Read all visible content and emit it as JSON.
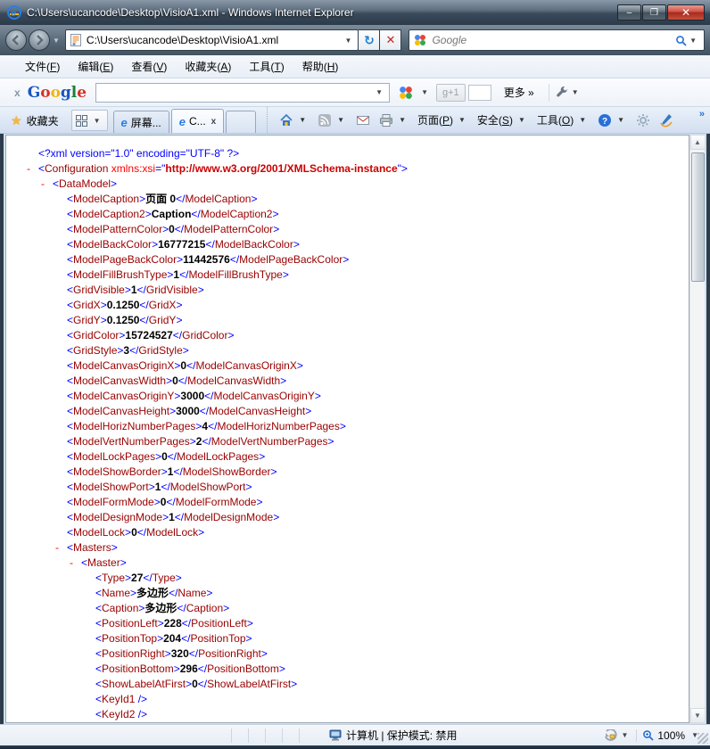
{
  "window": {
    "title": "C:\\Users\\ucancode\\Desktop\\VisioA1.xml - Windows Internet Explorer",
    "controls": {
      "minimize": "–",
      "maximize": "❐",
      "close": "✕"
    }
  },
  "nav": {
    "address": "C:\\Users\\ucancode\\Desktop\\VisioA1.xml",
    "refresh_glyph": "↻",
    "stop_glyph": "✕",
    "search_placeholder": "Google"
  },
  "menu": {
    "items": [
      "文件(F)",
      "编辑(E)",
      "查看(V)",
      "收藏夹(A)",
      "工具(T)",
      "帮助(H)"
    ]
  },
  "google_bar": {
    "close_glyph": "x",
    "logo_letters": [
      {
        "ch": "G",
        "color": "#1a56c4"
      },
      {
        "ch": "o",
        "color": "#d93025"
      },
      {
        "ch": "o",
        "color": "#f4b400"
      },
      {
        "ch": "g",
        "color": "#1a56c4"
      },
      {
        "ch": "l",
        "color": "#188038"
      },
      {
        "ch": "e",
        "color": "#d93025"
      }
    ],
    "plus_one_label": "g+1",
    "more_label": "更多 »"
  },
  "tab_bar": {
    "favorites_label": "收藏夹",
    "tabs": [
      {
        "label": "屏幕...",
        "active": false,
        "closable": false
      },
      {
        "label": "C...",
        "active": true,
        "closable": true
      }
    ],
    "text_commands": [
      {
        "label": "页面(P)"
      },
      {
        "label": "安全(S)"
      },
      {
        "label": "工具(O)"
      }
    ],
    "chevron_glyph": "»"
  },
  "content": {
    "lines": [
      {
        "type": "decl",
        "indent": 0,
        "text": "<?xml version=\"1.0\" encoding=\"UTF-8\" ?>"
      },
      {
        "type": "open",
        "indent": 0,
        "tag": "Configuration",
        "attr_name": "xmlns:xsi",
        "attr_value": "http://www.w3.org/2001/XMLSchema-instance"
      },
      {
        "type": "open",
        "indent": 1,
        "tag": "DataModel"
      },
      {
        "type": "leaf",
        "indent": 2,
        "tag": "ModelCaption",
        "value": "页面 0"
      },
      {
        "type": "leaf",
        "indent": 2,
        "tag": "ModelCaption2",
        "value": "Caption"
      },
      {
        "type": "leaf",
        "indent": 2,
        "tag": "ModelPatternColor",
        "value": "0"
      },
      {
        "type": "leaf",
        "indent": 2,
        "tag": "ModelBackColor",
        "value": "16777215"
      },
      {
        "type": "leaf",
        "indent": 2,
        "tag": "ModelPageBackColor",
        "value": "11442576"
      },
      {
        "type": "leaf",
        "indent": 2,
        "tag": "ModelFillBrushType",
        "value": "1"
      },
      {
        "type": "leaf",
        "indent": 2,
        "tag": "GridVisible",
        "value": "1"
      },
      {
        "type": "leaf",
        "indent": 2,
        "tag": "GridX",
        "value": "0.1250"
      },
      {
        "type": "leaf",
        "indent": 2,
        "tag": "GridY",
        "value": "0.1250"
      },
      {
        "type": "leaf",
        "indent": 2,
        "tag": "GridColor",
        "value": "15724527"
      },
      {
        "type": "leaf",
        "indent": 2,
        "tag": "GridStyle",
        "value": "3"
      },
      {
        "type": "leaf",
        "indent": 2,
        "tag": "ModelCanvasOriginX",
        "value": "0"
      },
      {
        "type": "leaf",
        "indent": 2,
        "tag": "ModelCanvasWidth",
        "value": "0"
      },
      {
        "type": "leaf",
        "indent": 2,
        "tag": "ModelCanvasOriginY",
        "value": "3000"
      },
      {
        "type": "leaf",
        "indent": 2,
        "tag": "ModelCanvasHeight",
        "value": "3000"
      },
      {
        "type": "leaf",
        "indent": 2,
        "tag": "ModelHorizNumberPages",
        "value": "4"
      },
      {
        "type": "leaf",
        "indent": 2,
        "tag": "ModelVertNumberPages",
        "value": "2"
      },
      {
        "type": "leaf",
        "indent": 2,
        "tag": "ModelLockPages",
        "value": "0"
      },
      {
        "type": "leaf",
        "indent": 2,
        "tag": "ModelShowBorder",
        "value": "1"
      },
      {
        "type": "leaf",
        "indent": 2,
        "tag": "ModelShowPort",
        "value": "1"
      },
      {
        "type": "leaf",
        "indent": 2,
        "tag": "ModelFormMode",
        "value": "0"
      },
      {
        "type": "leaf",
        "indent": 2,
        "tag": "ModelDesignMode",
        "value": "1"
      },
      {
        "type": "leaf",
        "indent": 2,
        "tag": "ModelLock",
        "value": "0"
      },
      {
        "type": "open",
        "indent": 2,
        "tag": "Masters"
      },
      {
        "type": "open",
        "indent": 3,
        "tag": "Master"
      },
      {
        "type": "leaf",
        "indent": 4,
        "tag": "Type",
        "value": "27"
      },
      {
        "type": "leaf",
        "indent": 4,
        "tag": "Name",
        "value": "多边形"
      },
      {
        "type": "leaf",
        "indent": 4,
        "tag": "Caption",
        "value": "多边形"
      },
      {
        "type": "leaf",
        "indent": 4,
        "tag": "PositionLeft",
        "value": "228"
      },
      {
        "type": "leaf",
        "indent": 4,
        "tag": "PositionTop",
        "value": "204"
      },
      {
        "type": "leaf",
        "indent": 4,
        "tag": "PositionRight",
        "value": "320"
      },
      {
        "type": "leaf",
        "indent": 4,
        "tag": "PositionBottom",
        "value": "296"
      },
      {
        "type": "leaf",
        "indent": 4,
        "tag": "ShowLabelAtFirst",
        "value": "0"
      },
      {
        "type": "empty",
        "indent": 4,
        "tag": "KeyId1"
      },
      {
        "type": "empty",
        "indent": 4,
        "tag": "KeyId2"
      }
    ]
  },
  "status_bar": {
    "zone_text": "计算机 | 保护模式: 禁用",
    "zoom_level": "100%"
  },
  "colors": {
    "xml_punct": "#0000ff",
    "xml_tag": "#990000",
    "xml_attr_name": "#ff0000",
    "xml_attr_value": "#cc0000",
    "xml_marker": "#ff0000",
    "titlebar_dark": "#2c3b4a",
    "close_red": "#a8291c"
  }
}
